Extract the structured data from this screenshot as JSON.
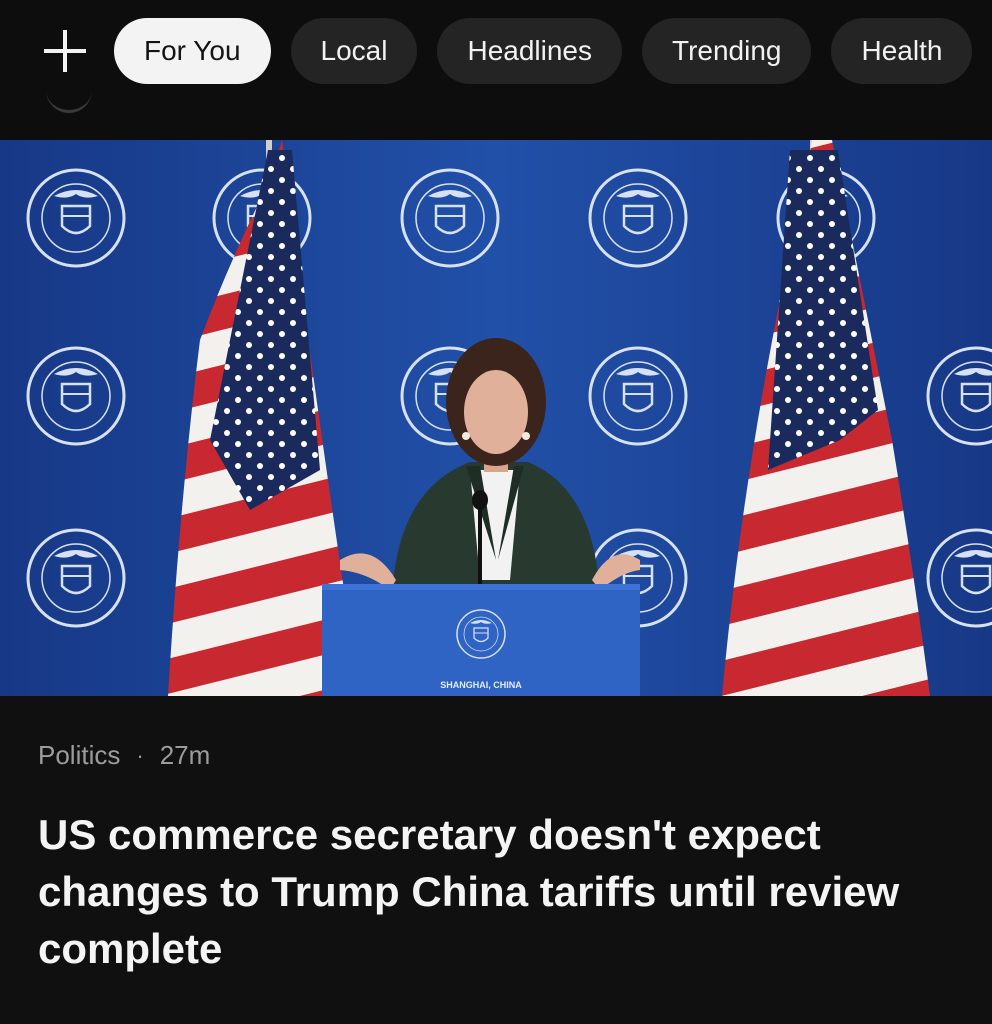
{
  "nav": {
    "add_icon": "plus-icon",
    "tabs": [
      {
        "label": "For You",
        "active": true
      },
      {
        "label": "Local",
        "active": false
      },
      {
        "label": "Headlines",
        "active": false
      },
      {
        "label": "Trending",
        "active": false
      },
      {
        "label": "Health",
        "active": false
      }
    ]
  },
  "article": {
    "podium_caption": "SHANGHAI, CHINA",
    "category": "Politics",
    "separator": "·",
    "age": "27m",
    "headline": "US commerce secretary doesn't expect changes to Trump China tariffs until review complete"
  },
  "colors": {
    "background": "#101010",
    "tab_bg": "#242424",
    "tab_active_bg": "#f3f3f3",
    "backdrop_blue": "#1d3f8f",
    "meta_gray": "#9c9c9c"
  }
}
